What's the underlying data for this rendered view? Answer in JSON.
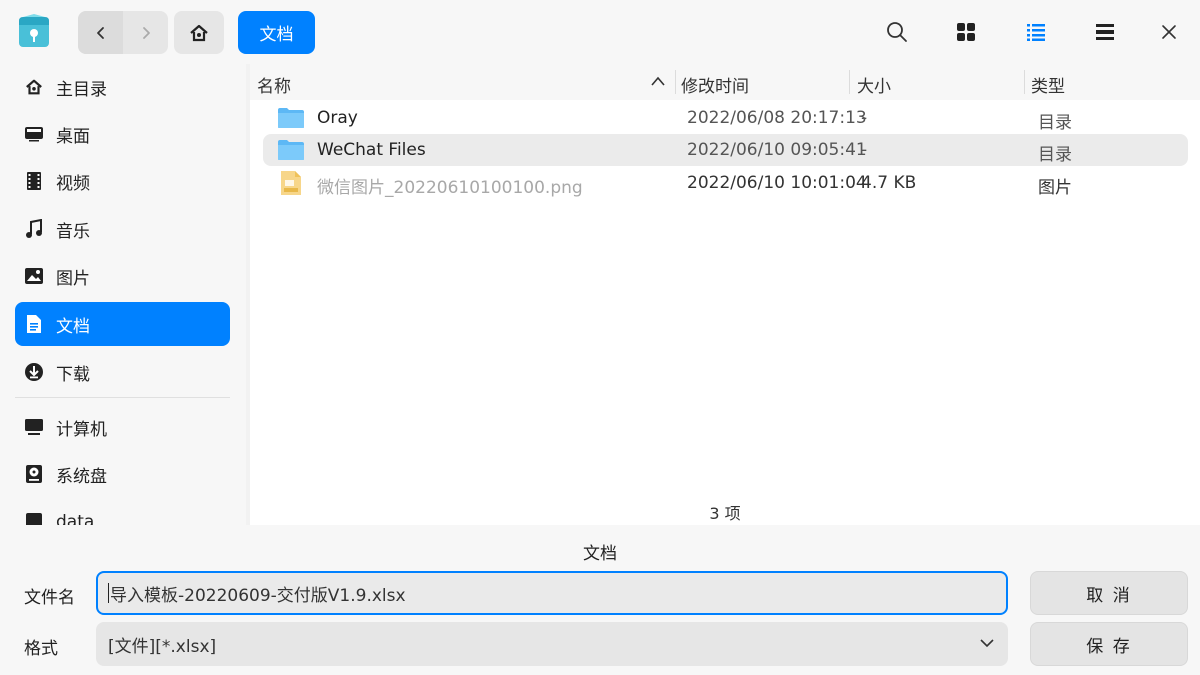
{
  "titlebar": {
    "breadcrumb_label": "文档",
    "icons": [
      "app-icon",
      "back-icon",
      "forward-icon",
      "home-icon",
      "search-icon",
      "icon-view-icon",
      "list-view-icon",
      "detail-view-icon",
      "close-icon"
    ]
  },
  "sidebar": {
    "items": [
      {
        "label": "主目录",
        "icon": "home-icon"
      },
      {
        "label": "桌面",
        "icon": "desktop-icon"
      },
      {
        "label": "视频",
        "icon": "video-icon"
      },
      {
        "label": "音乐",
        "icon": "music-icon"
      },
      {
        "label": "图片",
        "icon": "picture-icon"
      },
      {
        "label": "文档",
        "icon": "document-icon"
      },
      {
        "label": "下载",
        "icon": "download-icon"
      },
      {
        "label": "计算机",
        "icon": "computer-icon"
      },
      {
        "label": "系统盘",
        "icon": "disk-icon"
      },
      {
        "label": "data",
        "icon": "drive-icon"
      }
    ]
  },
  "columns": {
    "name": "名称",
    "modified": "修改时间",
    "size": "大小",
    "type": "类型"
  },
  "files": [
    {
      "name": "Oray",
      "modified": "2022/06/08 20:17:13",
      "size": "-",
      "type": "目录",
      "icon": "folder-icon"
    },
    {
      "name": "WeChat Files",
      "modified": "2022/06/10 09:05:41",
      "size": "-",
      "type": "目录",
      "icon": "folder-icon"
    },
    {
      "name": "微信图片_20220610100100.png",
      "modified": "2022/06/10 10:01:04",
      "size": "4.7 KB",
      "type": "图片",
      "icon": "png-file-icon"
    }
  ],
  "status": "3 项",
  "bottom": {
    "title": "文档",
    "filename_label": "文件名",
    "filename_value": "导入模板-20220609-交付版V1.9.xlsx",
    "format_label": "格式",
    "format_value": "[文件][*.xlsx]",
    "cancel_label": "取 消",
    "save_label": "保 存"
  },
  "colors": {
    "accent": "#0081ff",
    "folder": "#5db8f5"
  }
}
